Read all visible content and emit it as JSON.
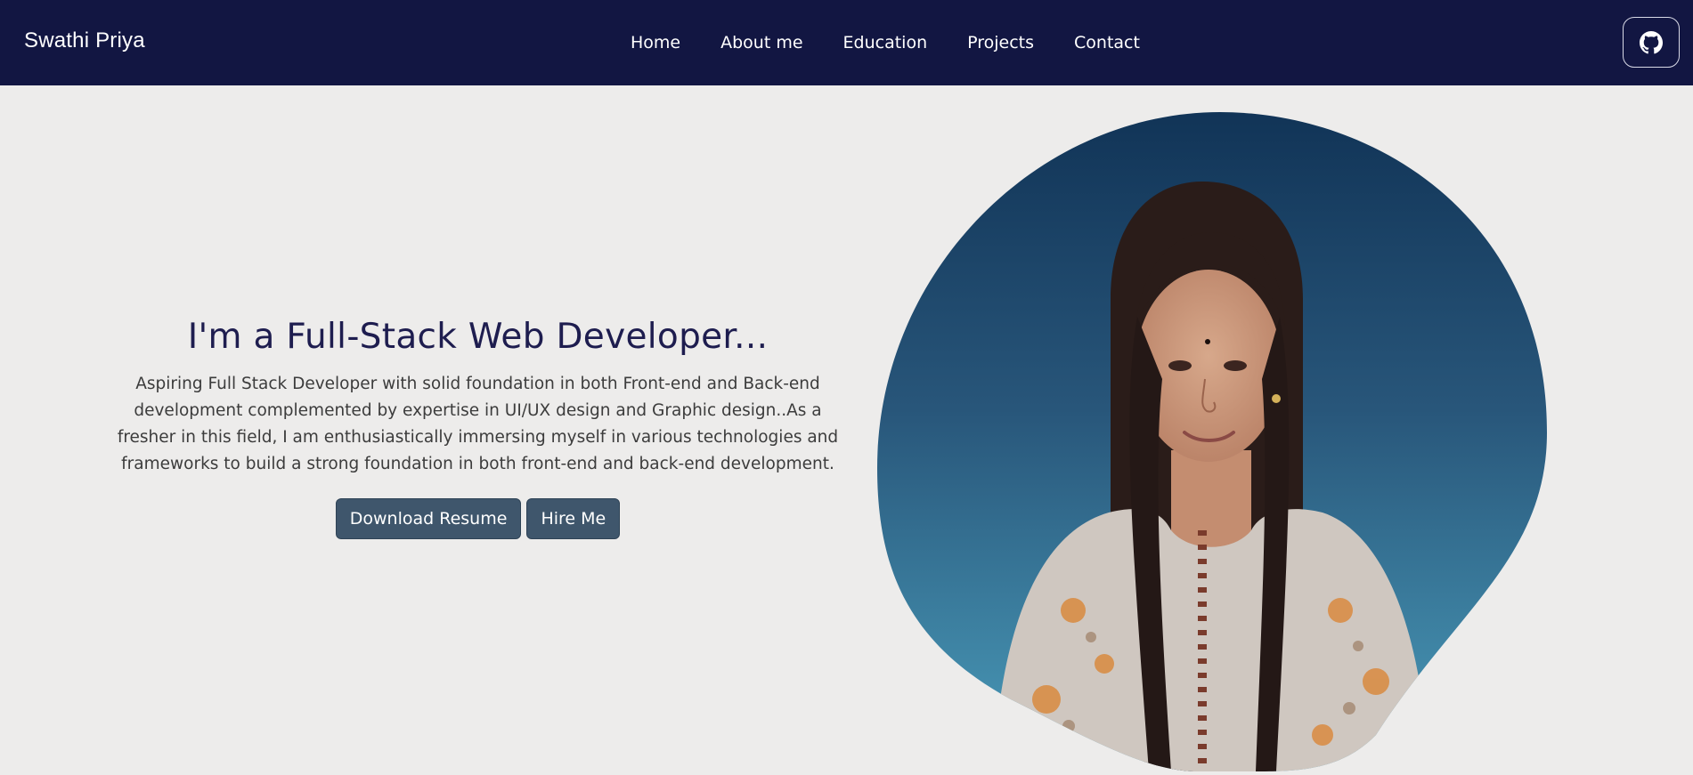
{
  "navbar": {
    "brand": "Swathi Priya",
    "links": [
      "Home",
      "About me",
      "Education",
      "Projects",
      "Contact"
    ],
    "github_icon": "github-icon"
  },
  "hero": {
    "title": "I'm a Full-Stack Web Developer...",
    "description": "Aspiring Full Stack Developer with solid foundation in both Front-end and Back-end development complemented by expertise in UI/UX design and Graphic design..As a fresher in this field, I am enthusiastically immersing myself in various technologies and frameworks to build a strong foundation in both front-end and back-end development.",
    "buttons": {
      "download": "Download Resume",
      "hire": "Hire Me"
    }
  },
  "colors": {
    "navbar_bg": "#121642",
    "page_bg": "#edeceb",
    "title": "#1e1d4f",
    "button_bg": "#3f566c",
    "blob_top": "#113457",
    "blob_bottom": "#4a9cba"
  }
}
